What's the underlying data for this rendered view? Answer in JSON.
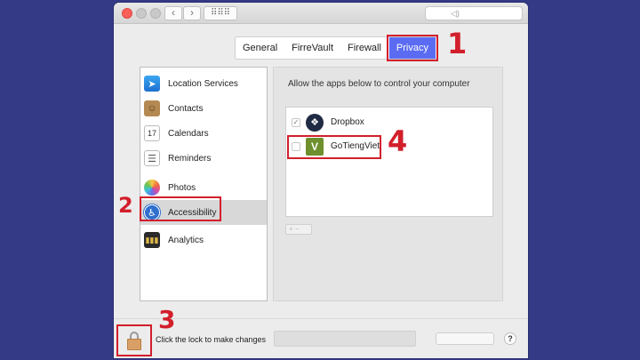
{
  "titlebar": {
    "back_glyph": "‹",
    "forward_glyph": "›",
    "grid_glyph": "⠿⠿⠿",
    "search_glyph": "◁)"
  },
  "tabs": [
    {
      "label": "General",
      "selected": false
    },
    {
      "label": "FirreVault",
      "selected": false
    },
    {
      "label": "Firewall",
      "selected": false
    },
    {
      "label": "Privacy",
      "selected": true
    }
  ],
  "sidebar": {
    "items": [
      {
        "label": "Location Services",
        "icon": "location-arrow-icon",
        "glyph": "➤"
      },
      {
        "label": "Contacts",
        "icon": "contacts-book-icon",
        "glyph": "☺"
      },
      {
        "label": "Calendars",
        "icon": "calendar-icon",
        "glyph": "17"
      },
      {
        "label": "Reminders",
        "icon": "reminders-list-icon",
        "glyph": "☰"
      },
      {
        "label": "Photos",
        "icon": "photos-flower-icon",
        "glyph": ""
      },
      {
        "label": "Accessibility",
        "icon": "accessibility-person-icon",
        "glyph": "♿",
        "selected": true
      },
      {
        "label": "Analytics",
        "icon": "analytics-bars-icon",
        "glyph": "▮▮▮"
      }
    ]
  },
  "content": {
    "allow_text": "Allow the apps below to control your computer",
    "apps": [
      {
        "label": "Dropbox",
        "checked": true,
        "check_glyph": "✓",
        "icon": "dropbox-icon",
        "glyph": "❖"
      },
      {
        "label": "GoTiengViet",
        "checked": false,
        "check_glyph": "",
        "icon": "gotiengviet-icon",
        "glyph": "V"
      }
    ],
    "plusminus_glyph": "+ −"
  },
  "bottom": {
    "lock_text": "Click the lock to make changes",
    "help_glyph": "?"
  },
  "annotations": {
    "step1": "1",
    "step2": "2",
    "step3": "3",
    "step4": "4"
  },
  "colors": {
    "background": "#343a85",
    "selected_tab": "#5b6cf3",
    "annotation_red": "#d21f2b"
  }
}
